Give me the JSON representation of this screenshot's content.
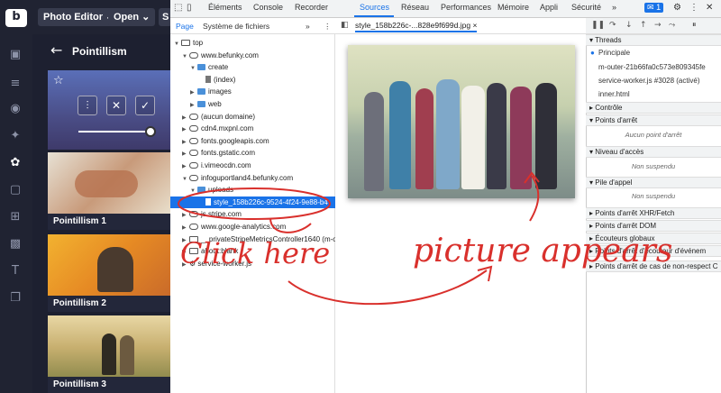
{
  "app": {
    "menu_photo_editor": "Photo Editor",
    "menu_open": "Open",
    "menu_partial": "S",
    "panel_title": "Pointillism",
    "thumb_labels": [
      "Pointillism 1",
      "Pointillism 2",
      "Pointillism 3"
    ]
  },
  "devtools": {
    "tabs": [
      "Éléments",
      "Console",
      "Recorder",
      "Sources",
      "Réseau",
      "Performances",
      "Mémoire",
      "Appli",
      "Sécurité"
    ],
    "more_tabs": "»",
    "badge": "1",
    "subtabs": [
      "Page",
      "Système de fichiers"
    ],
    "subtabs_more": "»",
    "tree": [
      {
        "label": "top",
        "indent": 0,
        "kind": "frame",
        "open": true
      },
      {
        "label": "www.befunky.com",
        "indent": 1,
        "kind": "cloud",
        "open": true
      },
      {
        "label": "create",
        "indent": 2,
        "kind": "folder",
        "open": true
      },
      {
        "label": "(index)",
        "indent": 3,
        "kind": "file"
      },
      {
        "label": "images",
        "indent": 2,
        "kind": "folder",
        "open": false
      },
      {
        "label": "web",
        "indent": 2,
        "kind": "folder",
        "open": false
      },
      {
        "label": "(aucun domaine)",
        "indent": 1,
        "kind": "cloud",
        "open": false
      },
      {
        "label": "cdn4.mxpnl.com",
        "indent": 1,
        "kind": "cloud",
        "open": false
      },
      {
        "label": "fonts.googleapis.com",
        "indent": 1,
        "kind": "cloud",
        "open": false
      },
      {
        "label": "fonts.gstatic.com",
        "indent": 1,
        "kind": "cloud",
        "open": false
      },
      {
        "label": "i.vimeocdn.com",
        "indent": 1,
        "kind": "cloud",
        "open": false
      },
      {
        "label": "infoguportland4.befunky.com",
        "indent": 1,
        "kind": "cloud",
        "open": true
      },
      {
        "label": "uploads",
        "indent": 2,
        "kind": "folder",
        "open": true
      },
      {
        "label": "style_158b226c-9524-4f24-9e88-b4",
        "indent": 3,
        "kind": "file",
        "selected": true
      },
      {
        "label": "js.stripe.com",
        "indent": 1,
        "kind": "cloud",
        "open": false
      },
      {
        "label": "www.google-analytics.com",
        "indent": 1,
        "kind": "cloud",
        "open": false
      },
      {
        "label": "__privateStripeMetricsController1640 (m-o",
        "indent": 1,
        "kind": "frame",
        "open": false
      },
      {
        "label": "about:blank",
        "indent": 1,
        "kind": "frame",
        "open": false
      },
      {
        "label": "service-worker.js",
        "indent": 1,
        "kind": "gear",
        "open": false
      }
    ],
    "open_file": "style_158b226c-...828e9f699d.jpg",
    "close_symbol": "×",
    "debugger": {
      "threads": "Threads",
      "thread_items": [
        "Principale",
        "m-outer-21b66fa0c573e809345fe",
        "service-worker.js #3028 (activé)",
        "inner.html"
      ],
      "controle": "Contrôle",
      "points_arret": "Points d'arrêt",
      "aucun_point": "Aucun point d'arrêt",
      "niveau_acces": "Niveau d'accès",
      "non_suspendu": "Non suspendu",
      "pile_appel": "Pile d'appel",
      "non_suspendu_2": "Non suspendu",
      "xhr": "Points d'arrêt XHR/Fetch",
      "dom": "Points d'arrêt DOM",
      "globaux": "Écouteurs globaux",
      "ecouteur": "Points d'arrêt d'écouteur d'événem",
      "cas": "Points d'arrêt de cas de non-respect C"
    }
  },
  "annotations": {
    "click_here": "Click here",
    "picture_appears": "picture appears"
  }
}
